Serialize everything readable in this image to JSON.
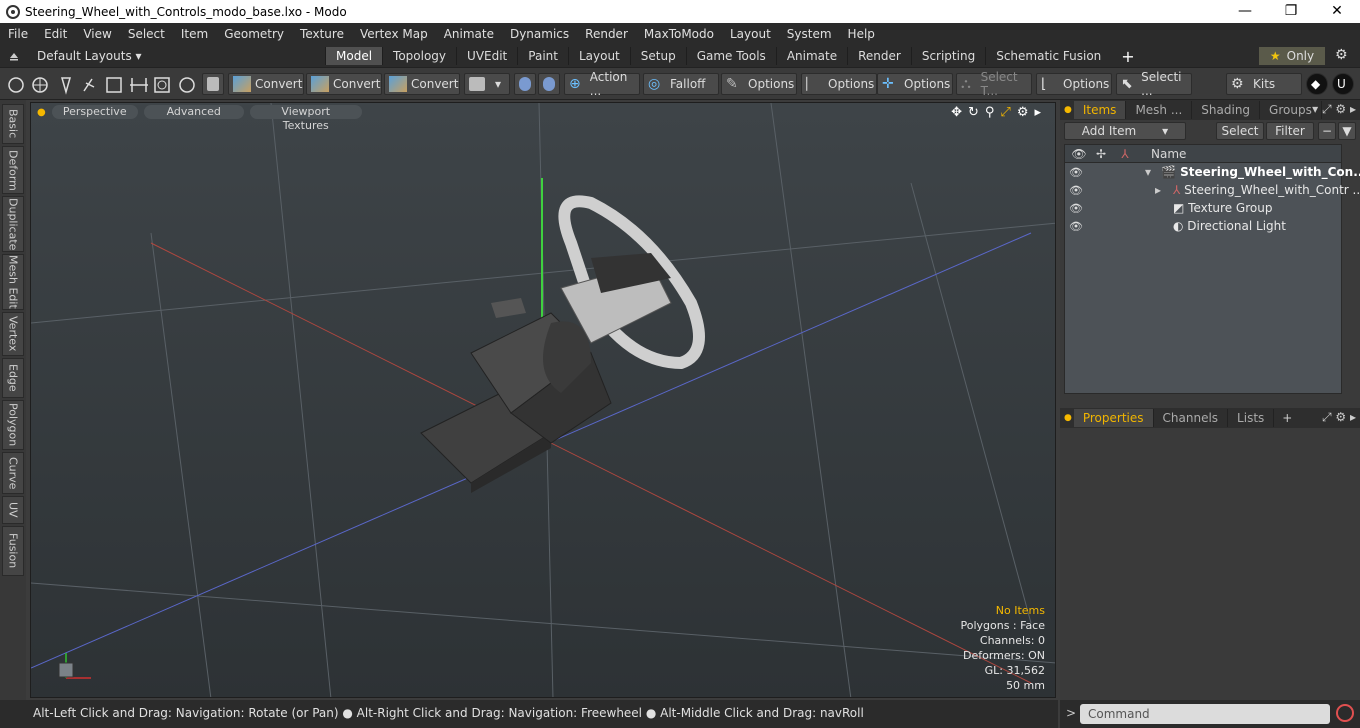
{
  "window": {
    "title": "Steering_Wheel_with_Controls_modo_base.lxo - Modo",
    "minimize": "—",
    "maximize": "❐",
    "close": "✕"
  },
  "menu": [
    "File",
    "Edit",
    "View",
    "Select",
    "Item",
    "Geometry",
    "Texture",
    "Vertex Map",
    "Animate",
    "Dynamics",
    "Render",
    "MaxToModo",
    "Layout",
    "System",
    "Help"
  ],
  "layouts": {
    "label": "Default Layouts ▾",
    "tabs": [
      "Model",
      "Topology",
      "UVEdit",
      "Paint",
      "Layout",
      "Setup",
      "Game Tools",
      "Animate",
      "Render",
      "Scripting",
      "Schematic Fusion"
    ],
    "active_tab": "Model",
    "add": "+",
    "only_label": "Only"
  },
  "toolbar": {
    "convert1": "Convert",
    "convert2": "Convert",
    "convert3": "Convert",
    "action": "Action ...",
    "falloff": "Falloff",
    "options1": "Options",
    "options2": "Options",
    "options3": "Options",
    "select_t": "Select T...",
    "options4": "Options",
    "selecti": "Selecti ...",
    "kits": "Kits"
  },
  "side_tabs": [
    "Basic",
    "Deform",
    "Duplicate",
    "Mesh Edit",
    "Vertex",
    "Edge",
    "Polygon",
    "Curve",
    "UV",
    "Fusion"
  ],
  "viewport": {
    "perspective": "Perspective",
    "advanced": "Advanced",
    "textures": "Viewport Textures",
    "info": {
      "no_items": "No Items",
      "polygons": "Polygons : Face",
      "channels": "Channels: 0",
      "deformers": "Deformers: ON",
      "gl": "GL: 31,562",
      "scale": "50 mm"
    }
  },
  "status": "Alt-Left Click and Drag: Navigation: Rotate (or Pan) ● Alt-Right Click and Drag: Navigation: Freewheel ● Alt-Middle Click and Drag: navRoll",
  "items_panel": {
    "tabs": [
      "Items",
      "Mesh ...",
      "Shading",
      "Groups"
    ],
    "add_item": "Add Item",
    "select": "Select",
    "filter": "Filter",
    "name_header": "Name",
    "rows": [
      {
        "label": "Steering_Wheel_with_Con..."
      },
      {
        "label": "Steering_Wheel_with_Contr ..."
      },
      {
        "label": "Texture Group"
      },
      {
        "label": "Directional Light"
      }
    ]
  },
  "props_panel": {
    "tabs": [
      "Properties",
      "Channels",
      "Lists"
    ],
    "add": "+"
  },
  "command": {
    "placeholder": "Command",
    "prompt": ">"
  }
}
